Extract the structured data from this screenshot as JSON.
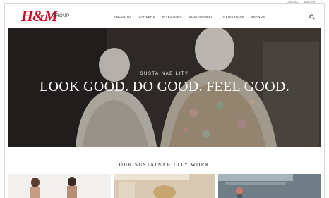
{
  "header": {
    "logo_text": "H&M",
    "group_label": "GROUP",
    "nav_items": [
      "ABOUT US",
      "CAREERS",
      "INVESTORS",
      "SUSTAINABILITY",
      "NEWSROOM",
      "BRANDS"
    ],
    "top_links": [
      "CONTACT",
      "ENGLISH"
    ],
    "search_icon": "search-icon"
  },
  "hero": {
    "eyebrow": "SUSTAINABILITY",
    "title": "LOOK GOOD. DO GOOD. FEEL GOOD."
  },
  "section": {
    "heading": "OUR SUSTAINABILITY WORK"
  },
  "colors": {
    "brand_red": "#d6001c"
  }
}
